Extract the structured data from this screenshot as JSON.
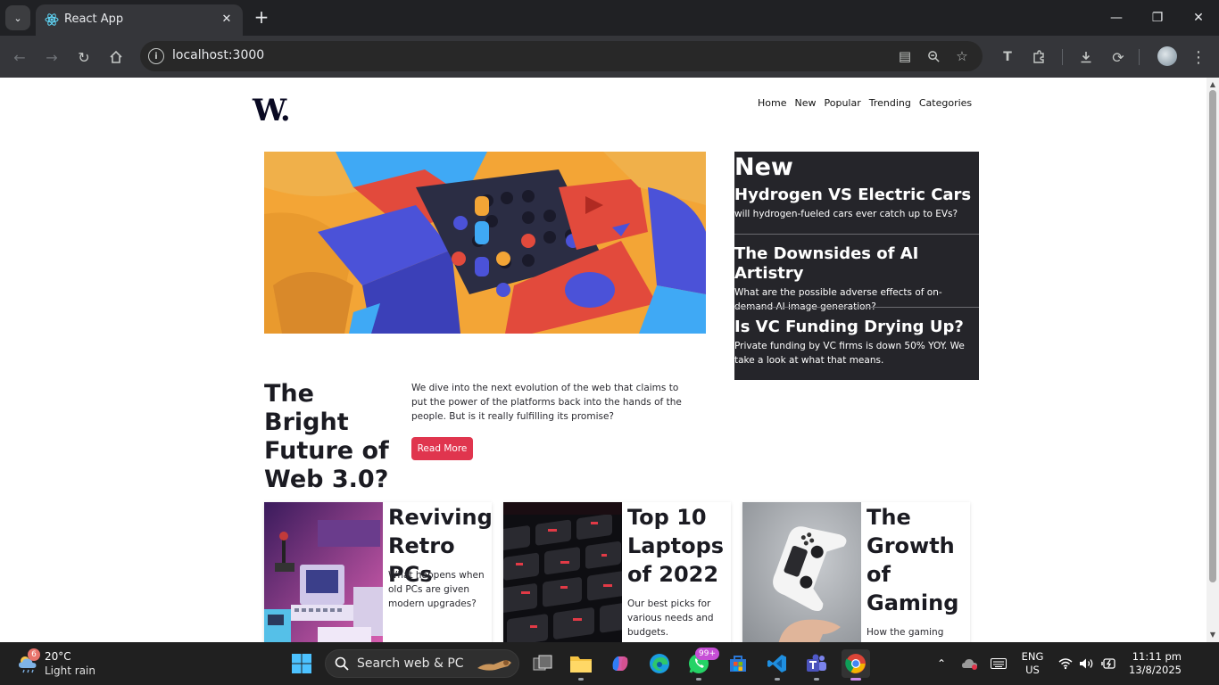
{
  "browser": {
    "tab_title": "React App",
    "url": "localhost:3000"
  },
  "page": {
    "logo": "W.",
    "nav": [
      "Home",
      "New",
      "Popular",
      "Trending",
      "Categories"
    ],
    "sidebar": {
      "heading": "New",
      "items": [
        {
          "title": "Hydrogen VS Electric Cars",
          "desc": "will hydrogen-fueled cars ever catch up to EVs?"
        },
        {
          "title": "The Downsides of AI Artistry",
          "desc": "What are the possible adverse effects of on-demand AI image generation?"
        },
        {
          "title": "Is VC Funding Drying Up?",
          "desc": "Private funding by VC firms is down 50% YOY. We take a look at what that means."
        }
      ]
    },
    "feature": {
      "title": "The Bright Future of Web 3.0?",
      "desc": "We dive into the next evolution of the web that claims to put the power of the platforms back into the hands of the people. But is it really fulfilling its promise?",
      "button": "Read More"
    },
    "cards": [
      {
        "title": "Reviving Retro PCs",
        "desc": "What happens when old PCs are given modern upgrades?"
      },
      {
        "title": "Top 10 Laptops of 2022",
        "desc": "Our best picks for various needs and budgets."
      },
      {
        "title": "The Growth of Gaming",
        "desc": "How the gaming"
      }
    ],
    "accent_color": "#e0354e",
    "sidebar_bg": "#25252a"
  },
  "taskbar": {
    "weather_badge": "6",
    "temperature": "20°C",
    "weather": "Light rain",
    "search_placeholder": "Search web & PC",
    "whatsapp_badge": "99+",
    "lang_top": "ENG",
    "lang_bottom": "US",
    "time": "11:11 pm",
    "date": "13/8/2025"
  }
}
